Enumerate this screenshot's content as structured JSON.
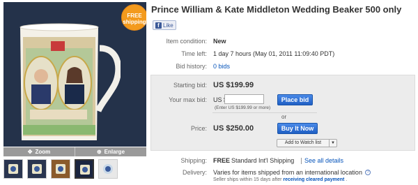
{
  "badge": {
    "line1": "FREE",
    "line2": "shipping"
  },
  "image_toolbar": {
    "zoom_label": "Zoom",
    "enlarge_label": "Enlarge"
  },
  "title": "Prince William & Kate Middleton Wedding Beaker 500 only",
  "like": {
    "label": "Like"
  },
  "details": {
    "condition_label": "Item condition:",
    "condition_value": "New",
    "time_left_label": "Time left:",
    "time_left_value": "1 day 7 hours (May 01, 2011 11:09:40 PDT)",
    "bid_history_label": "Bid history:",
    "bid_history_value": "0 bids"
  },
  "bidding": {
    "starting_bid_label": "Starting bid:",
    "starting_bid_value": "US $199.99",
    "max_bid_label": "Your max bid:",
    "currency_prefix": "US $",
    "max_bid_input_value": "",
    "hint": "(Enter US $199.99 or more)",
    "place_bid_label": "Place bid",
    "or_label": "or",
    "price_label": "Price:",
    "price_value": "US $250.00",
    "buy_now_label": "Buy It Now",
    "watch_label": "Add to Watch list",
    "watch_arrow": "▼"
  },
  "shipping": {
    "label": "Shipping:",
    "free": "FREE",
    "method": "Standard Int'l Shipping",
    "see_all": "See all details"
  },
  "delivery": {
    "label": "Delivery:",
    "value": "Varies for items shipped from an international location",
    "info": "?",
    "note_prefix": "Seller ships within 15 days after",
    "note_link": "receiving cleared payment",
    "note_suffix": "."
  },
  "colors": {
    "link": "#0654ba",
    "button_blue": "#2a6fd4",
    "badge_orange": "#f39a1d"
  }
}
